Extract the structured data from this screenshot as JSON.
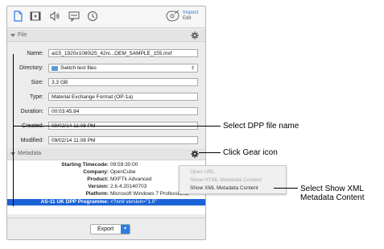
{
  "toolbar": {
    "icons": [
      "file-icon",
      "video-icon",
      "audio-icon",
      "subtitle-icon",
      "clock-icon"
    ],
    "inspect_label": "Inspect",
    "edit_label": "Edit"
  },
  "file_section": {
    "title": "File",
    "fields": {
      "name_label": "Name:",
      "name_value": "ai15_1920x1080i25_42ni...OEM_SAMPLE_155.mxf",
      "directory_label": "Directory:",
      "directory_value": "Switch test files",
      "size_label": "Size:",
      "size_value": "3.3 GB",
      "type_label": "Type:",
      "type_value": "Material Exchange Format (OP-1a)",
      "duration_label": "Duration:",
      "duration_value": "00:03:45.84",
      "created_label": "Created:",
      "created_value": "09/02/14 11:08 PM",
      "modified_label": "Modified:",
      "modified_value": "09/02/14 11:08 PM"
    }
  },
  "metadata_section": {
    "title": "Metadata",
    "rows": [
      {
        "key": "Starting Timecode:",
        "value": "09:59:30:00"
      },
      {
        "key": "Company:",
        "value": "OpenCube"
      },
      {
        "key": "Product:",
        "value": "MXFTk Advanced"
      },
      {
        "key": "Version:",
        "value": "2.6.4.20140703"
      },
      {
        "key": "Platform:",
        "value": "Microsoft Windows 7 Professional"
      },
      {
        "key": "AS-11 UK DPP Programme:",
        "value": "<?xml version=\"1.0\""
      }
    ]
  },
  "context_menu": {
    "items": [
      "Open URL",
      "Show HTML Metadata Content",
      "Show XML Metadata Content"
    ]
  },
  "export": {
    "label": "Export"
  },
  "callouts": {
    "dpp_file": "Select DPP file name",
    "gear": "Click Gear icon",
    "xml_line1": "Select Show XML",
    "xml_line2": "Metadata Content"
  }
}
